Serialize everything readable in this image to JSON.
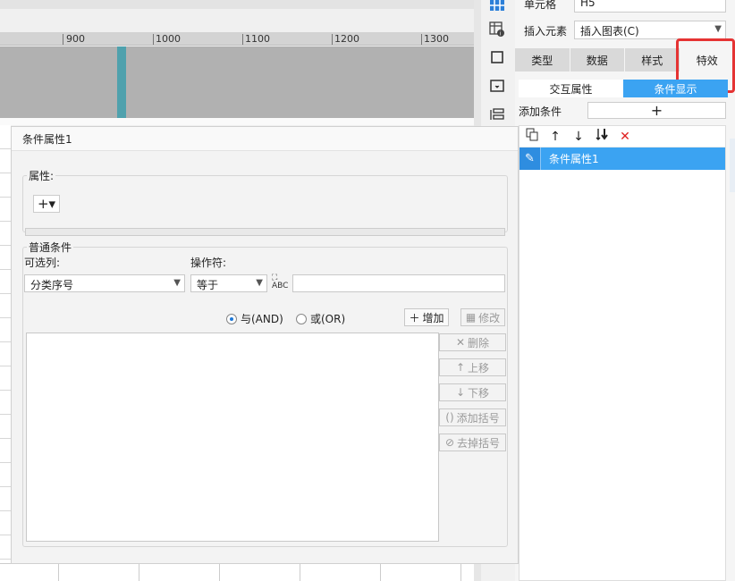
{
  "ruler": {
    "marks": [
      "900",
      "1000",
      "1100",
      "1200",
      "1300"
    ]
  },
  "colors": {
    "accent": "#3ba3f2",
    "highlight_box": "#e53333",
    "canvas_marker": "#4fa1ad"
  },
  "side_icons": [
    "grid-icon",
    "table-settings-icon",
    "frame-icon",
    "widget-icon",
    "layout-icon"
  ],
  "right_panel": {
    "cell": {
      "label": "单元格",
      "value": "H5"
    },
    "insert": {
      "label": "插入元素",
      "value": "插入图表(C)"
    },
    "tabs": [
      "类型",
      "数据",
      "样式",
      "特效"
    ],
    "active_tab": "特效",
    "subtabs": [
      "交互属性",
      "条件显示"
    ],
    "active_subtab": "条件显示",
    "add_condition_label": "添加条件",
    "add_condition_button": "+",
    "toolbar": {
      "copy": "copy-icon",
      "up": "↑",
      "down": "↓",
      "move_bottom": "move-to-bottom-icon",
      "delete": "✕"
    },
    "conditions": [
      {
        "name": "条件属性1"
      }
    ]
  },
  "dialog": {
    "title": "条件属性1",
    "attributes": {
      "legend": "属性:",
      "add_button": "+▾"
    },
    "general": {
      "legend": "普通条件",
      "column_label": "可选列:",
      "column_value": "分类序号",
      "operator_label": "操作符:",
      "operator_value": "等于",
      "value_type_icon": "abc-formula-icon",
      "value": "",
      "radio_and": "与(AND)",
      "radio_or": "或(OR)",
      "radio_selected": "and",
      "buttons": {
        "add": "增加",
        "modify": "修改",
        "delete": "删除",
        "move_up": "上移",
        "move_down": "下移",
        "add_bracket": "添加括号",
        "remove_bracket": "去掉括号"
      }
    }
  }
}
